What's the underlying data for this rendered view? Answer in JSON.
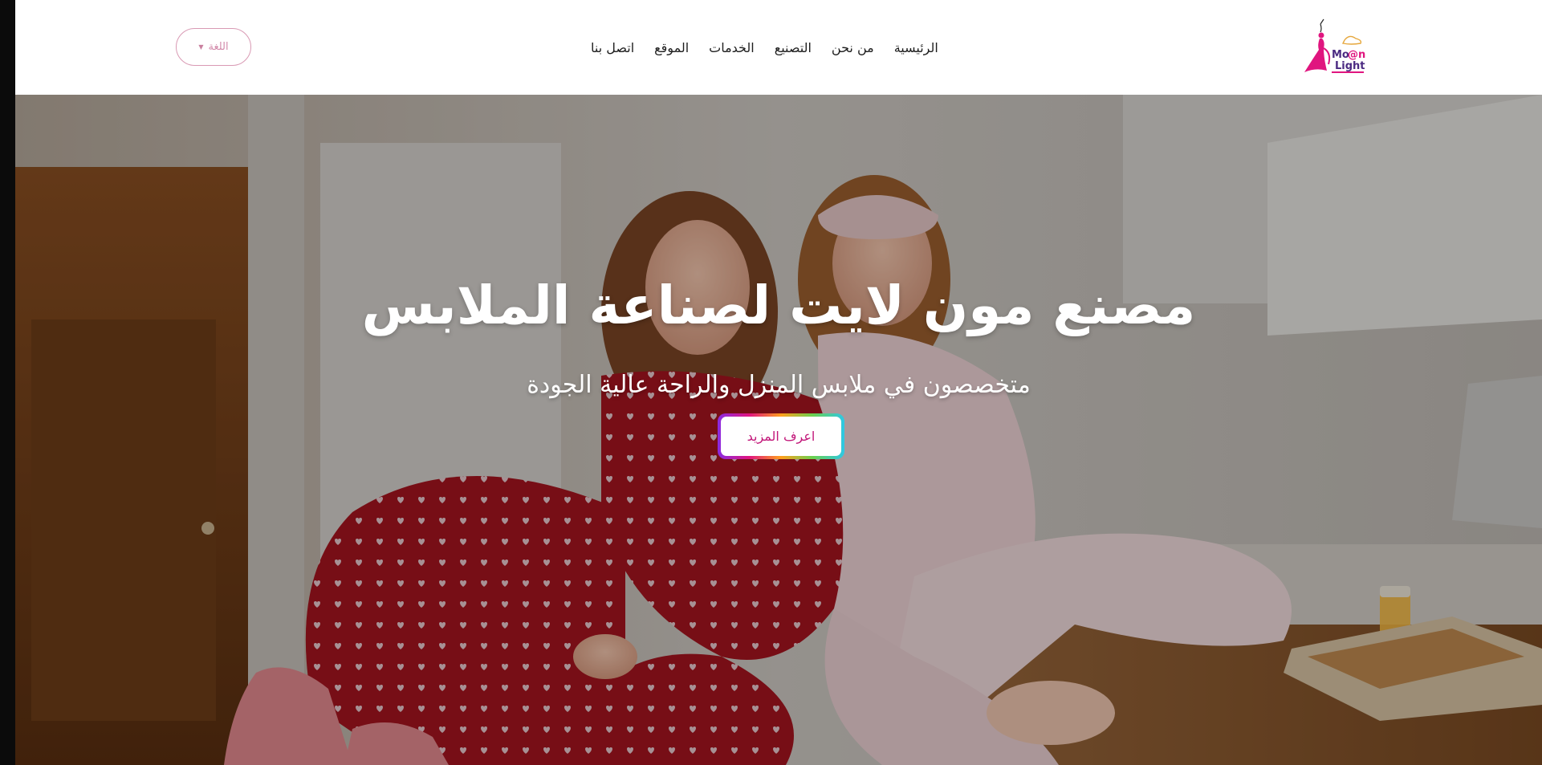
{
  "header": {
    "logo_alt": "Moon Light",
    "language_button": "اللغة",
    "nav": [
      {
        "label": "الرئيسية"
      },
      {
        "label": "من نحن"
      },
      {
        "label": "التصنيع"
      },
      {
        "label": "الخدمات"
      },
      {
        "label": "الموقع"
      },
      {
        "label": "اتصل بنا"
      }
    ]
  },
  "hero": {
    "title": "مصنع مون لايت لصناعة الملابس",
    "subtitle": "متخصصون في ملابس المنزل والراحة عالية الجودة",
    "cta_label": "اعرف المزيد"
  },
  "colors": {
    "brand_pink": "#e0157f",
    "nav_text": "#1e1e1e",
    "cta_text": "#c2187a"
  }
}
